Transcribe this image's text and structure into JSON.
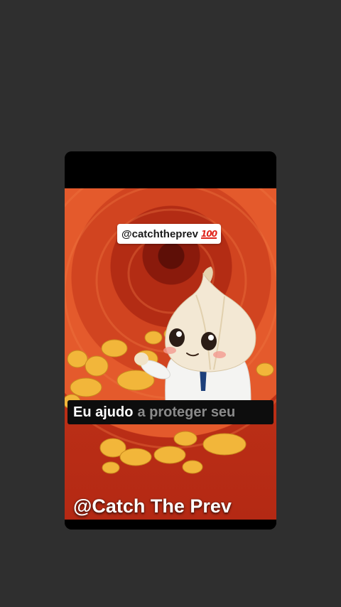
{
  "story": {
    "mention_sticker": {
      "text": "@catchtheprev",
      "emoji_icon": "hundred-points-icon",
      "emoji_glyph": "100"
    },
    "caption": {
      "highlighted": "Eu ajudo",
      "rest": "a proteger seu"
    },
    "watermark": "@Catch The Prev"
  },
  "colors": {
    "background": "#2f2f2f",
    "caption_bg": "#0d0d0d",
    "caption_highlight": "#ffffff",
    "caption_rest": "#8a8a8a",
    "emoji_red": "#e0241b"
  }
}
